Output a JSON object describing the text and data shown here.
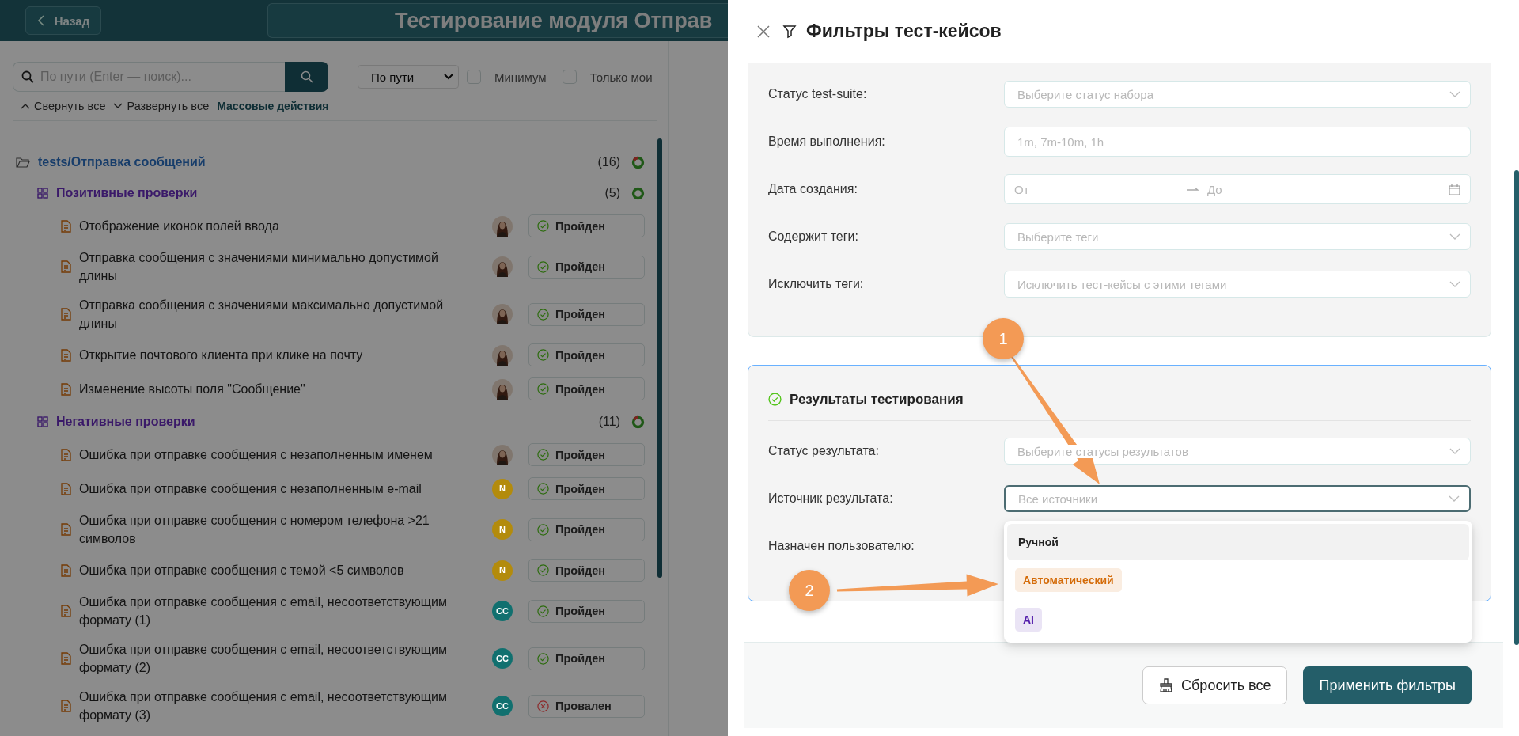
{
  "header": {
    "back_button": "Назад",
    "title": "Тестирование модуля Отправ"
  },
  "search": {
    "placeholder": "По пути (Enter — поиск)..."
  },
  "sort_select": {
    "value": "По пути"
  },
  "checkboxes": [
    {
      "label": "Минимум",
      "checked": false
    },
    {
      "label": "Только мои",
      "checked": false
    }
  ],
  "actions": [
    {
      "label": "Свернуть все",
      "kind": "collapse"
    },
    {
      "label": "Развернуть все",
      "kind": "expand"
    },
    {
      "label": "Массовые действия",
      "kind": "plain"
    }
  ],
  "tree": {
    "label": "tests/Отправка сообщений",
    "count": "(16)",
    "has_failures": true,
    "children": [
      {
        "label": "Позитивные проверки",
        "count": "(5)",
        "has_failures": false,
        "children": [
          {
            "title": "Отображение иконок полей ввода",
            "avatar": {
              "kind": "photo"
            },
            "status": {
              "kind": "passed",
              "label": "Пройден"
            }
          },
          {
            "title": "Отправка сообщения с значениями минимально допустимой длины",
            "avatar": {
              "kind": "photo"
            },
            "status": {
              "kind": "passed",
              "label": "Пройден"
            }
          },
          {
            "title": "Отправка сообщения с значениями максимально допустимой длины",
            "avatar": {
              "kind": "photo"
            },
            "status": {
              "kind": "passed",
              "label": "Пройден"
            }
          },
          {
            "title": "Открытие почтового клиента при клике на почту",
            "avatar": {
              "kind": "photo"
            },
            "status": {
              "kind": "passed",
              "label": "Пройден"
            }
          },
          {
            "title": "Изменение высоты поля \"Сообщение\"",
            "avatar": {
              "kind": "photo"
            },
            "status": {
              "kind": "passed",
              "label": "Пройден"
            }
          }
        ]
      },
      {
        "label": "Негативные проверки",
        "count": "(11)",
        "has_failures": true,
        "children": [
          {
            "title": "Ошибка при отправке сообщения с незаполненным именем",
            "avatar": {
              "kind": "photo"
            },
            "status": {
              "kind": "passed",
              "label": "Пройден"
            }
          },
          {
            "title": "Ошибка при отправке сообщения с незаполненным e-mail",
            "avatar": {
              "kind": "initials",
              "text": "N",
              "color": "#b38b0c"
            },
            "status": {
              "kind": "passed",
              "label": "Пройден"
            }
          },
          {
            "title": "Ошибка при отправке сообщения с номером телефона >21 символов",
            "avatar": {
              "kind": "initials",
              "text": "N",
              "color": "#b38b0c"
            },
            "status": {
              "kind": "passed",
              "label": "Пройден"
            }
          },
          {
            "title": "Ошибка при отправке сообщения с темой <5 символов",
            "avatar": {
              "kind": "initials",
              "text": "N",
              "color": "#b38b0c"
            },
            "status": {
              "kind": "passed",
              "label": "Пройден"
            }
          },
          {
            "title": "Ошибка при отправке сообщения с email, несоответствующим формату (1)",
            "avatar": {
              "kind": "initials",
              "text": "CC",
              "color": "#11706f"
            },
            "status": {
              "kind": "passed",
              "label": "Пройден"
            }
          },
          {
            "title": "Ошибка при отправке сообщения с email, несоответствующим формату (2)",
            "avatar": {
              "kind": "initials",
              "text": "CC",
              "color": "#11706f"
            },
            "status": {
              "kind": "passed",
              "label": "Пройден"
            }
          },
          {
            "title": "Ошибка при отправке сообщения с email, несоответствующим формату (3)",
            "avatar": {
              "kind": "initials",
              "text": "CC",
              "color": "#11706f"
            },
            "status": {
              "kind": "failed",
              "label": "Провален"
            }
          }
        ]
      }
    ]
  },
  "drawer": {
    "title": "Фильтры тест-кейсов",
    "filters": [
      {
        "label": "Статус test-suite:",
        "kind": "select",
        "placeholder": "Выберите статус набора"
      },
      {
        "label": "Время выполнения:",
        "kind": "input",
        "placeholder": "1m, 7m-10m, 1h"
      },
      {
        "label": "Дата создания:",
        "kind": "date_range",
        "from_placeholder": "От",
        "to_placeholder": "До"
      },
      {
        "label": "Содержит теги:",
        "kind": "select",
        "placeholder": "Выберите теги"
      },
      {
        "label": "Исключить теги:",
        "kind": "select",
        "placeholder": "Исключить тест-кейсы с этими тегами"
      }
    ],
    "results": {
      "title": "Результаты тестирования",
      "filters": [
        {
          "label": "Статус результата:",
          "kind": "select",
          "placeholder": "Выберите статусы результатов",
          "focused": false
        },
        {
          "label": "Источник результата:",
          "kind": "select",
          "placeholder": "Все источники",
          "focused": true
        },
        {
          "label": "Назначен пользователю:",
          "kind": "covered"
        }
      ]
    },
    "dropdown": {
      "options": [
        {
          "label": "Ручной",
          "hovered": true
        },
        {
          "label": "Автоматический",
          "hovered": false,
          "color": "#d46b08"
        },
        {
          "label": "AI",
          "hovered": false,
          "color": "#531dab"
        }
      ]
    },
    "buttons": [
      {
        "label": "Сбросить все",
        "kind": "reset"
      },
      {
        "label": "Применить фильтры",
        "kind": "primary"
      }
    ]
  },
  "annotations": [
    {
      "label": "1"
    },
    {
      "label": "2"
    }
  ]
}
